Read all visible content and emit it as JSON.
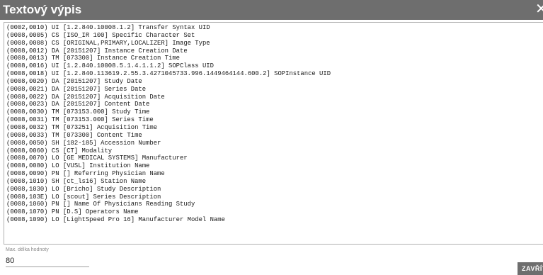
{
  "dialog": {
    "title": "Textový výpis",
    "close_glyph": "✕",
    "lines": [
      "(0002,0010) UI [1.2.840.10008.1.2] Transfer Syntax UID",
      "(0008,0005) CS [ISO_IR 100] Specific Character Set",
      "(0008,0008) CS [ORIGINAL,PRIMARY,LOCALIZER] Image Type",
      "(0008,0012) DA [20151207] Instance Creation Date",
      "(0008,0013) TM [073300] Instance Creation Time",
      "(0008,0016) UI [1.2.840.10008.5.1.4.1.1.2] SOPClass UID",
      "(0008,0018) UI [1.2.840.113619.2.55.3.4271045733.996.1449464144.600.2] SOPInstance UID",
      "(0008,0020) DA [20151207] Study Date",
      "(0008,0021) DA [20151207] Series Date",
      "(0008,0022) DA [20151207] Acquisition Date",
      "(0008,0023) DA [20151207] Content Date",
      "(0008,0030) TM [073153.000] Study Time",
      "(0008,0031) TM [073153.000] Series Time",
      "(0008,0032) TM [073251] Acquisition Time",
      "(0008,0033) TM [073300] Content Time",
      "(0008,0050) SH [182-185] Accession Number",
      "(0008,0060) CS [CT] Modality",
      "(0008,0070) LO [GE MEDICAL SYSTEMS] Manufacturer",
      "(0008,0080) LO [VUSL] Institution Name",
      "(0008,0090) PN [] Referring Physician Name",
      "(0008,1010) SH [ct_ls16] Station Name",
      "(0008,1030) LO [Bricho] Study Description",
      "(0008,103E) LO [scout] Series Description",
      "(0008,1060) PN [] Name Of Physicians Reading Study",
      "(0008,1070) PN [D.S] Operators Name",
      "(0008,1090) LO [LightSpeed Pro 16] Manufacturer Model Name"
    ],
    "max_length_label": "Max. délka hodnoty",
    "max_length_value": "80",
    "close_button_label": "ZAVŘÍT"
  }
}
